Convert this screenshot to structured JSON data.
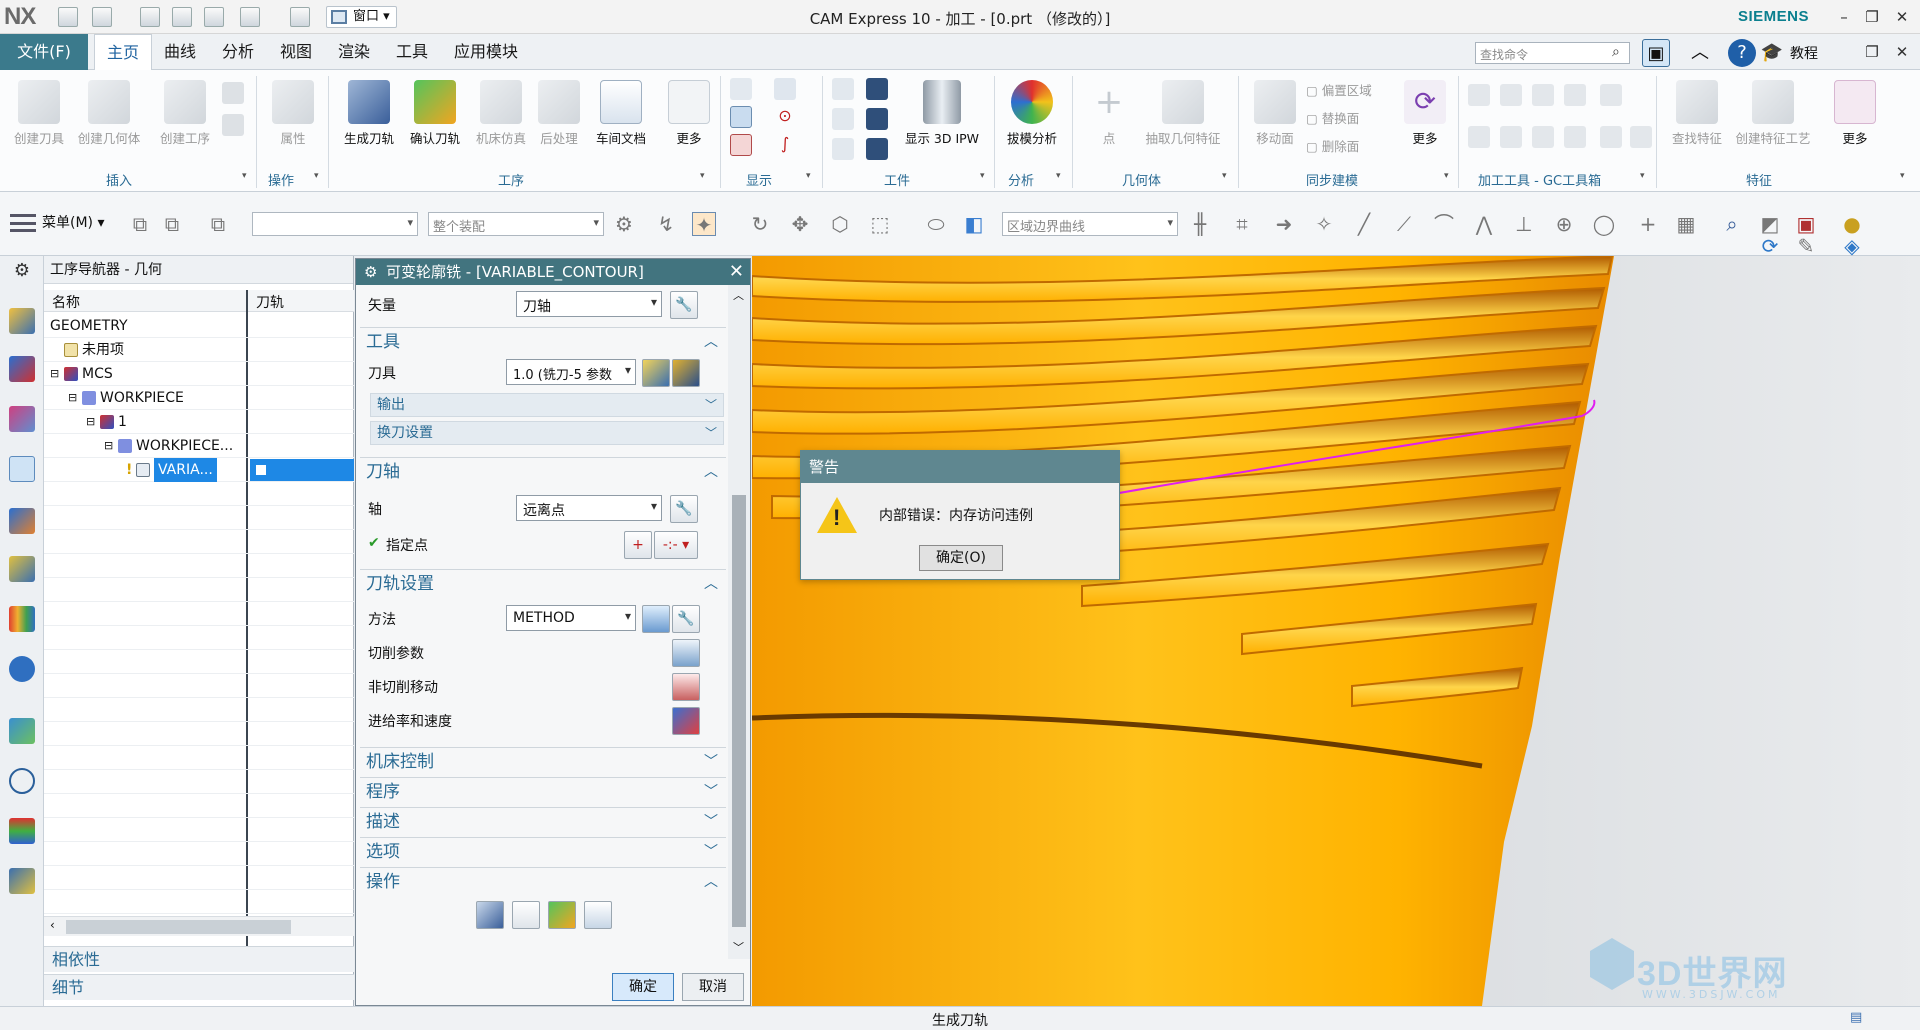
{
  "titlebar": {
    "logo": "NX",
    "window_menu": "窗口",
    "app_title": "CAM Express 10 - 加工 - [0.prt （修改的）]",
    "brand": "SIEMENS"
  },
  "menubar": {
    "file": "文件(F)",
    "tabs": [
      "主页",
      "曲线",
      "分析",
      "视图",
      "渲染",
      "工具",
      "应用模块"
    ],
    "active_tab": "主页",
    "search_placeholder": "查找命令",
    "tutorial": "教程"
  },
  "ribbon": {
    "groups": {
      "insert": {
        "label": "插入",
        "buttons": [
          "创建刀具",
          "创建几何体",
          "创建工序"
        ]
      },
      "operation": {
        "label": "操作",
        "buttons": [
          "属性"
        ]
      },
      "process": {
        "label": "工序",
        "buttons": [
          "生成刀轨",
          "确认刀轨",
          "机床仿真",
          "后处理",
          "车间文档",
          "更多"
        ]
      },
      "display": {
        "label": "显示"
      },
      "workpiece": {
        "label": "工件",
        "buttons": [
          "显示 3D IPW"
        ]
      },
      "analysis": {
        "label": "分析",
        "buttons": [
          "拔模分析"
        ]
      },
      "geometry": {
        "label": "几何体",
        "buttons": [
          "点",
          "抽取几何特征"
        ]
      },
      "sync": {
        "label": "同步建模",
        "buttons": [
          "移动面",
          "偏置区域",
          "替换面",
          "删除面",
          "更多"
        ]
      },
      "gc": {
        "label": "加工工具 - GC工具箱"
      },
      "feature": {
        "label": "特征",
        "buttons": [
          "查找特征",
          "创建特征工艺",
          "更多"
        ]
      }
    }
  },
  "toolbar2": {
    "menu": "菜单(M)",
    "filter_placeholder": "",
    "assembly_scope": "整个装配",
    "curve_rule": "区域边界曲线"
  },
  "navigator": {
    "title": "工序导航器 - 几何",
    "col_name": "名称",
    "col_path": "刀轨",
    "rows": [
      "GEOMETRY",
      "未用项",
      "MCS",
      "WORKPIECE",
      "1",
      "WORKPIECE...",
      "VARIA..."
    ],
    "panels": [
      "相依性",
      "细节"
    ]
  },
  "dialog": {
    "title": "可变轮廓铣 - [VARIABLE_CONTOUR]",
    "vector_label": "矢量",
    "vector_value": "刀轴",
    "tool_section": "工具",
    "tool_label": "刀具",
    "tool_value": "1.0 (铣刀-5 参数",
    "output": "输出",
    "tool_change": "换刀设置",
    "axis_section": "刀轴",
    "axis_label": "轴",
    "axis_value": "远离点",
    "specify_point": "指定点",
    "path_section": "刀轨设置",
    "method_label": "方法",
    "method_value": "METHOD",
    "cut_params": "切削参数",
    "non_cut": "非切削移动",
    "feeds": "进给率和速度",
    "sections_collapsed": [
      "机床控制",
      "程序",
      "描述",
      "选项"
    ],
    "actions_section": "操作",
    "ok": "确定",
    "cancel": "取消"
  },
  "warning": {
    "title": "警告",
    "message": "内部错误：内存访问违例",
    "ok": "确定(O)"
  },
  "viewport": {
    "watermark": "3D世界网",
    "watermark_url": "WWW.3DSJW.COM"
  },
  "status": "生成刀轨"
}
